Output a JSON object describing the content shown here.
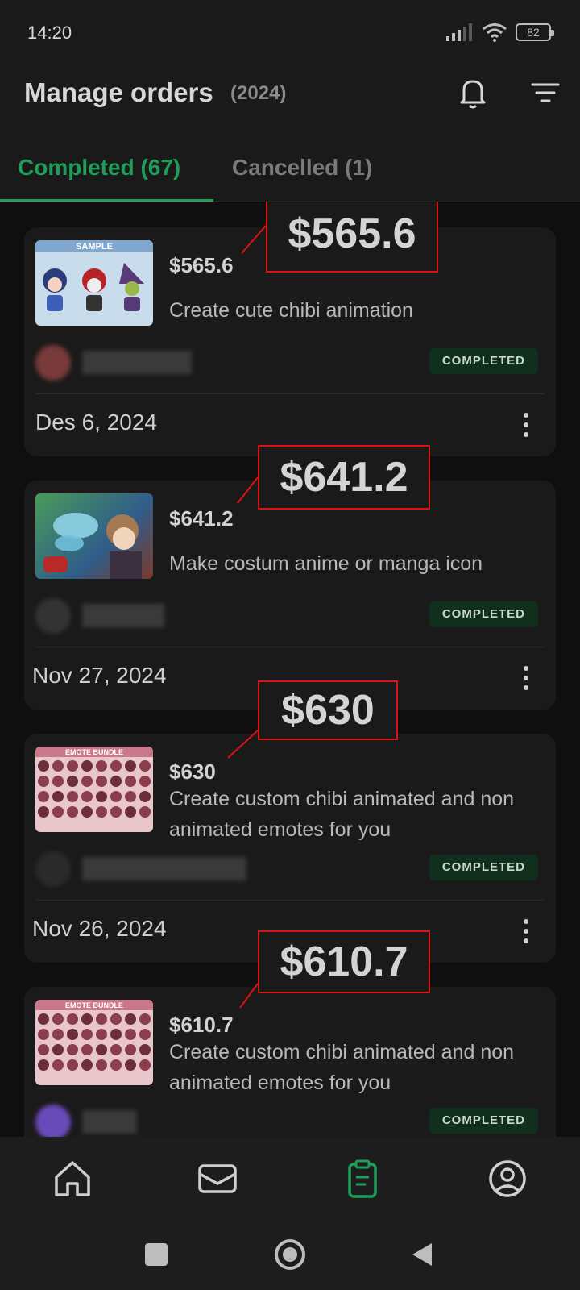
{
  "status": {
    "time": "14:20",
    "battery": "82"
  },
  "header": {
    "title": "Manage orders",
    "year": "(2024)"
  },
  "tabs": [
    {
      "label": "Completed (67)",
      "active": true
    },
    {
      "label": "Cancelled (1)",
      "active": false
    }
  ],
  "orders": [
    {
      "price": "$565.6",
      "description": "Create cute chibi animation",
      "status": "COMPLETED",
      "date": "Des 6, 2024",
      "thumb_text": "SAMPLE"
    },
    {
      "price": "$641.2",
      "description": "Make costum anime or manga icon",
      "status": "COMPLETED",
      "date": "Nov 27, 2024"
    },
    {
      "price": "$630",
      "description": "Create custom chibi animated and non animated emotes for you",
      "status": "COMPLETED",
      "date": "Nov 26, 2024",
      "thumb_text": "EMOTE BUNDLE"
    },
    {
      "price": "$610.7",
      "description": "Create custom chibi animated and non animated emotes for you",
      "status": "COMPLETED",
      "thumb_text": "EMOTE BUNDLE"
    }
  ],
  "callouts": [
    "$565.6",
    "$641.2",
    "$630",
    "$610.7"
  ],
  "nav": {
    "items": [
      {
        "icon": "home-icon",
        "active": false
      },
      {
        "icon": "mail-icon",
        "active": false
      },
      {
        "icon": "orders-clipboard-icon",
        "active": true
      },
      {
        "icon": "profile-icon",
        "active": false
      }
    ]
  },
  "colors": {
    "accent": "#1e9e58",
    "callout_border": "#e01010",
    "background": "#141414"
  }
}
